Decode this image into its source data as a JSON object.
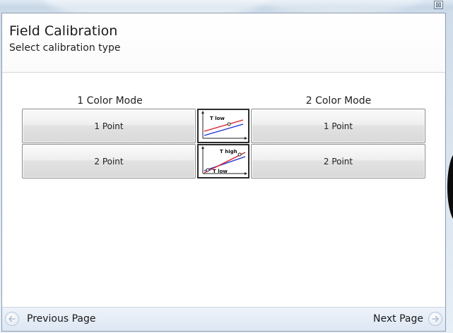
{
  "window": {
    "close_glyph": "⊠"
  },
  "header": {
    "title": "Field Calibration",
    "subtitle": "Select calibration type"
  },
  "modes": {
    "one_color": {
      "label": "1 Color Mode",
      "one_point": "1 Point",
      "two_point": "2 Point"
    },
    "two_color": {
      "label": "2 Color Mode",
      "one_point": "1 Point",
      "two_point": "2 Point"
    }
  },
  "thumbnails": {
    "one_point": {
      "label_low": "T low",
      "icon": "one-point-calibration-graph-icon"
    },
    "two_point": {
      "label_high": "T high",
      "label_low": "T low",
      "icon": "two-point-calibration-graph-icon"
    }
  },
  "footer": {
    "previous": "Previous Page",
    "next": "Next Page"
  },
  "colors": {
    "line_red": "#d81f26",
    "line_blue": "#1f2fd0",
    "accent_blue": "#c7d7e7"
  }
}
